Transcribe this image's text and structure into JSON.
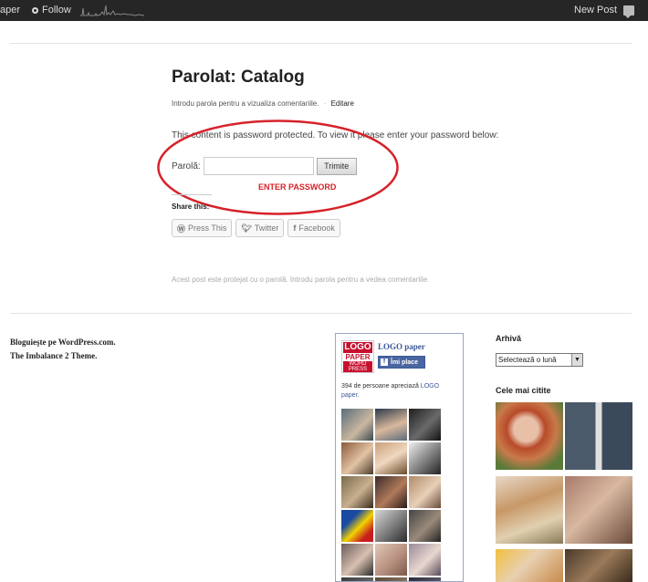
{
  "adminbar": {
    "site_name": "aper",
    "follow_label": "Follow",
    "new_post_label": "New Post"
  },
  "post": {
    "title": "Parolat: Catalog",
    "meta_text": "Introdu parola pentru a vizualiza comentariile.",
    "meta_sep": "·",
    "edit_label": "Editare",
    "protected_message": "This content is password protected. To view it please enter your password below:",
    "password_label": "Parolă:",
    "password_value": "",
    "submit_label": "Trimite",
    "annotation": "ENTER PASSWORD",
    "annotation_color": "#d6222a",
    "share_title": "Share this:",
    "share_buttons": [
      {
        "label": "Press This",
        "icon": "wordpress-icon"
      },
      {
        "label": "Twitter",
        "icon": "twitter-icon"
      },
      {
        "label": "Facebook",
        "icon": "facebook-icon"
      }
    ],
    "protected_note": "Acest post este protejat cu o parolă. Introdu parola pentru a vedea comentariile."
  },
  "footer": {
    "credit_1": "Bloguieşte pe WordPress.com.",
    "credit_2": "The Imbalance 2 Theme."
  },
  "facebook_widget": {
    "logo_line1": "LOGO",
    "logo_line2": "PAPER",
    "logo_line3": "WORD PRESS",
    "page_name": "LOGO paper",
    "like_label": "Îmi place",
    "count_text": "394 de persoane apreciază ",
    "count_link": "LOGO paper",
    "count_end": ".",
    "brand_color": "#3b5998"
  },
  "archive_widget": {
    "title": "Arhivă",
    "select_value": "Selectează o lună"
  },
  "popular_widget": {
    "title": "Cele mai citite"
  }
}
